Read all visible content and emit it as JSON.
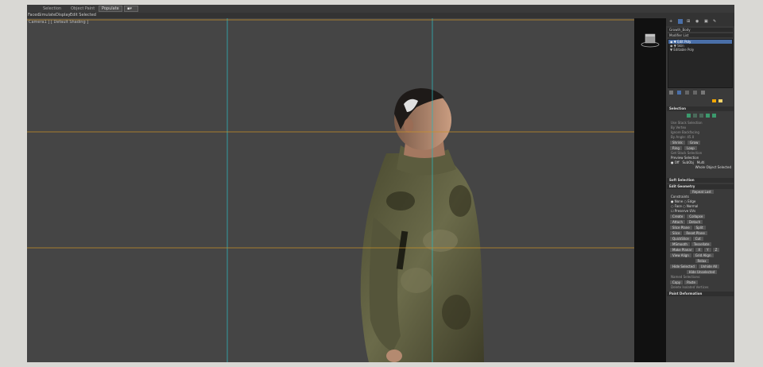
{
  "toolbar": {
    "left_label": "",
    "selection_label": "Selection",
    "object_paint_label": "Object Paint",
    "populate_label": "Populate"
  },
  "menu": {
    "items": [
      "Faces",
      "Simulate",
      "Display",
      "Edit Selected"
    ]
  },
  "viewport": {
    "label": "Camera1 ] [ Default Shading ]"
  },
  "panel": {
    "object_name": "Growth_Body",
    "modifier_list": "Modifier List",
    "stack": [
      {
        "label": "Edit Poly",
        "selected": true
      },
      {
        "label": "Skin",
        "selected": false
      },
      {
        "label": "Editable Poly",
        "selected": false
      }
    ],
    "stack_markers": [
      "◉ ▼",
      "◉ ▼",
      "▼"
    ],
    "selection_title": "Selection",
    "selection_lines": [
      "Use Stack Selection",
      "By Vertex",
      "Ignore Backfacing",
      "By Angle: 45.0",
      "Shrink",
      "Grow",
      "Ring",
      "Loop",
      "Get Stack Selection"
    ],
    "preview_selection": "Preview Selection",
    "preview_off": "Off",
    "preview_subobj": "SubObj",
    "preview_multi": "Multi",
    "whole_object": "Whole Object Selected",
    "soft_selection_title": "Soft Selection",
    "edit_geometry_title": "Edit Geometry",
    "repeat_last": "Repeat Last",
    "constraints": "Constraints",
    "constraint_options": [
      "None",
      "Edge",
      "Face",
      "Normal"
    ],
    "preserve_uvs": "Preserve UVs",
    "buttons": [
      "Create",
      "Collapse",
      "Attach",
      "Detach",
      "Slice Plane",
      "Split",
      "Slice",
      "Reset Plane",
      "QuickSlice",
      "Cut",
      "MSmooth",
      "Tessellate",
      "Make Planar",
      "X",
      "Y",
      "Z",
      "View Align",
      "Grid Align",
      "Relax",
      "Hide Selected",
      "Unhide All",
      "Hide Unselected"
    ],
    "named_selections": "Named Selections:",
    "copy": "Copy",
    "paste": "Paste",
    "delete_isolated": "Delete Isolated Vertices",
    "paint_deformation_title": "Paint Deformation"
  },
  "colors": {
    "accent": "#4a6fa8",
    "grid_cyan": "#2fb3b8",
    "grid_orange": "#c8902a"
  }
}
